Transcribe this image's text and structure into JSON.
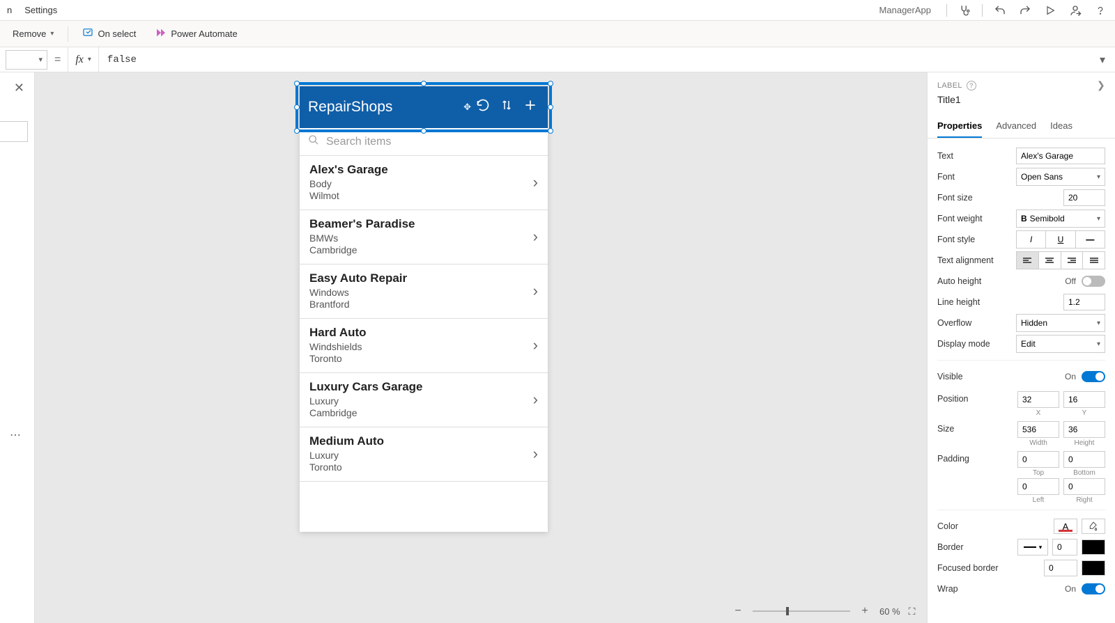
{
  "menubar": {
    "items": [
      "n",
      "Settings"
    ],
    "app_name": "ManagerApp"
  },
  "toolbar": {
    "remove": "Remove",
    "on_select": "On select",
    "power_automate": "Power Automate"
  },
  "formula": {
    "value": "false"
  },
  "preview": {
    "header_title": "RepairShops",
    "search_placeholder": "Search items",
    "items": [
      {
        "name": "Alex's Garage",
        "sub1": "Body",
        "sub2": "Wilmot"
      },
      {
        "name": "Beamer's Paradise",
        "sub1": "BMWs",
        "sub2": "Cambridge"
      },
      {
        "name": "Easy Auto Repair",
        "sub1": "Windows",
        "sub2": "Brantford"
      },
      {
        "name": "Hard Auto",
        "sub1": "Windshields",
        "sub2": "Toronto"
      },
      {
        "name": "Luxury Cars Garage",
        "sub1": "Luxury",
        "sub2": "Cambridge"
      },
      {
        "name": "Medium Auto",
        "sub1": "Luxury",
        "sub2": "Toronto"
      }
    ]
  },
  "zoom": {
    "pct": "60",
    "pct_suffix": "%"
  },
  "props": {
    "category": "LABEL",
    "control_name": "Title1",
    "tabs": [
      "Properties",
      "Advanced",
      "Ideas"
    ],
    "labels": {
      "text": "Text",
      "font": "Font",
      "font_size": "Font size",
      "font_weight": "Font weight",
      "font_style": "Font style",
      "text_alignment": "Text alignment",
      "auto_height": "Auto height",
      "line_height": "Line height",
      "overflow": "Overflow",
      "display_mode": "Display mode",
      "visible": "Visible",
      "position": "Position",
      "size": "Size",
      "padding": "Padding",
      "color": "Color",
      "border": "Border",
      "focused_border": "Focused border",
      "wrap": "Wrap"
    },
    "values": {
      "text": "Alex's Garage",
      "font": "Open Sans",
      "font_size": "20",
      "font_weight": "Semibold",
      "auto_height": "Off",
      "line_height": "1.2",
      "overflow": "Hidden",
      "display_mode": "Edit",
      "visible": "On",
      "position_x": "32",
      "position_y": "16",
      "size_w": "536",
      "size_h": "36",
      "padding_top": "0",
      "padding_bottom": "0",
      "padding_left": "0",
      "padding_right": "0",
      "border_width": "0",
      "focused_border_width": "0",
      "wrap": "On"
    },
    "sublabels": {
      "x": "X",
      "y": "Y",
      "width": "Width",
      "height": "Height",
      "top": "Top",
      "bottom": "Bottom",
      "left": "Left",
      "right": "Right"
    }
  }
}
